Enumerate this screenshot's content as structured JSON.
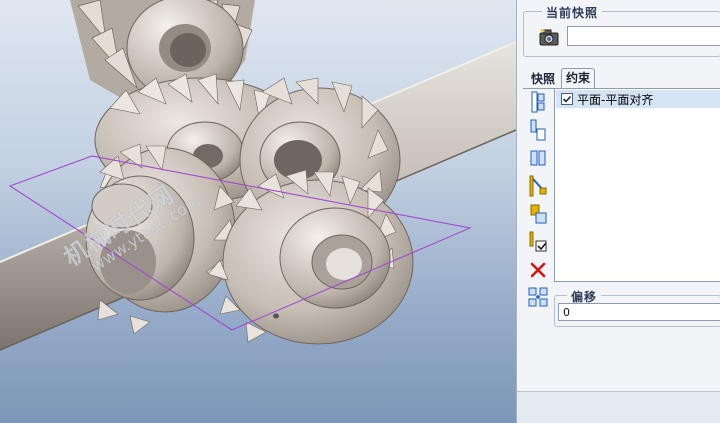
{
  "snapshot": {
    "group_title": "当前快照",
    "camera_icon": "camera-icon",
    "name_value": ""
  },
  "tabs": [
    {
      "label": "快照"
    },
    {
      "label": "约束"
    }
  ],
  "active_tab": "约束",
  "constraint_tools": [
    "align-edges-icon",
    "mate-offset-icon",
    "parallel-planes-icon",
    "pick-point-icon",
    "orient-components-icon",
    "confirm-check-icon",
    "delete-x-icon"
  ],
  "constraints": [
    {
      "label": "平面-平面对齐",
      "checked": true
    }
  ],
  "offset": {
    "group_title": "偏移",
    "value": "0",
    "icon": "offset-arrows-icon"
  },
  "watermark": {
    "text": "机械时代网",
    "url": "www.ytaac.com"
  },
  "colors": {
    "viewport_top": "#dfe7f1",
    "viewport_bottom": "#7e96b8",
    "gear": "#c6bdb4",
    "datum_plane": "#a24bd0",
    "selection": "#d4e4f4"
  }
}
